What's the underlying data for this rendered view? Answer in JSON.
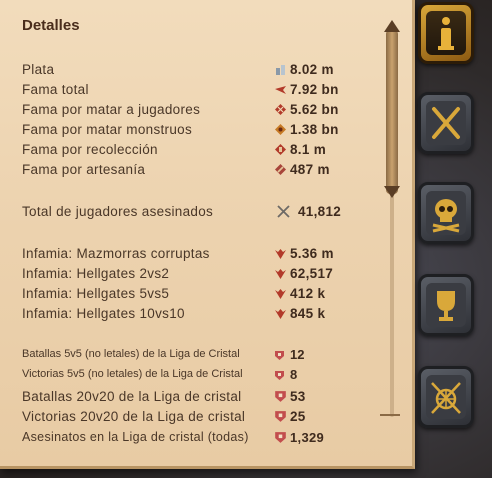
{
  "panel": {
    "title": "Detalles"
  },
  "rows": [
    {
      "label": "Plata",
      "value": "8.02 m",
      "icon": "silver-icon"
    },
    {
      "label": "Fama total",
      "value": "7.92 bn",
      "icon": "fame-icon"
    },
    {
      "label": "Fama por matar a jugadores",
      "value": "5.62 bn",
      "icon": "fame-pvp-icon"
    },
    {
      "label": "Fama por matar monstruos",
      "value": "1.38 bn",
      "icon": "fame-pve-icon"
    },
    {
      "label": "Fama por recolección",
      "value": "8.1 m",
      "icon": "fame-gathering-icon"
    },
    {
      "label": "Fama por artesanía",
      "value": "487 m",
      "icon": "fame-crafting-icon"
    },
    {
      "label": "Total de jugadores asesinados",
      "value": "41,812",
      "icon": "crossed-swords-icon"
    },
    {
      "label": "Infamia: Mazmorras corruptas",
      "value": "5.36 m",
      "icon": "infamy-icon"
    },
    {
      "label": "Infamia: Hellgates 2vs2",
      "value": "62,517",
      "icon": "infamy-icon"
    },
    {
      "label": "Infamia: Hellgates 5vs5",
      "value": "412 k",
      "icon": "infamy-icon"
    },
    {
      "label": "Infamia: Hellgates 10vs10",
      "value": "845 k",
      "icon": "infamy-icon"
    },
    {
      "label": "Batallas 5v5 (no letales) de la Liga de Cristal",
      "value": "12",
      "icon": "crystal-league-icon"
    },
    {
      "label": "Victorias 5v5 (no letales) de la Liga de Cristal",
      "value": "8",
      "icon": "crystal-league-icon"
    },
    {
      "label": "Batallas 20v20 de la Liga de cristal",
      "value": "53",
      "icon": "crystal-league-icon"
    },
    {
      "label": "Victorias 20v20 de la Liga de cristal",
      "value": "25",
      "icon": "crystal-league-icon"
    },
    {
      "label": "Asesinatos en la Liga de cristal (todas)",
      "value": "1,329",
      "icon": "crystal-league-icon"
    }
  ],
  "tabs": [
    {
      "name": "info-tab",
      "icon": "info-icon",
      "active": true
    },
    {
      "name": "pvp-tab",
      "icon": "crossed-swords-icon",
      "active": false
    },
    {
      "name": "deaths-tab",
      "icon": "skull-icon",
      "active": false
    },
    {
      "name": "achievements-tab",
      "icon": "trophy-icon",
      "active": false
    },
    {
      "name": "guild-warfare-tab",
      "icon": "globe-swords-icon",
      "active": false
    }
  ],
  "colors": {
    "panel_bg": "#ecd2ae",
    "text": "#4a3728",
    "value_text": "#3f2b1e",
    "accent_gold": "#d9a83a",
    "fame_red": "#b23a2a"
  }
}
